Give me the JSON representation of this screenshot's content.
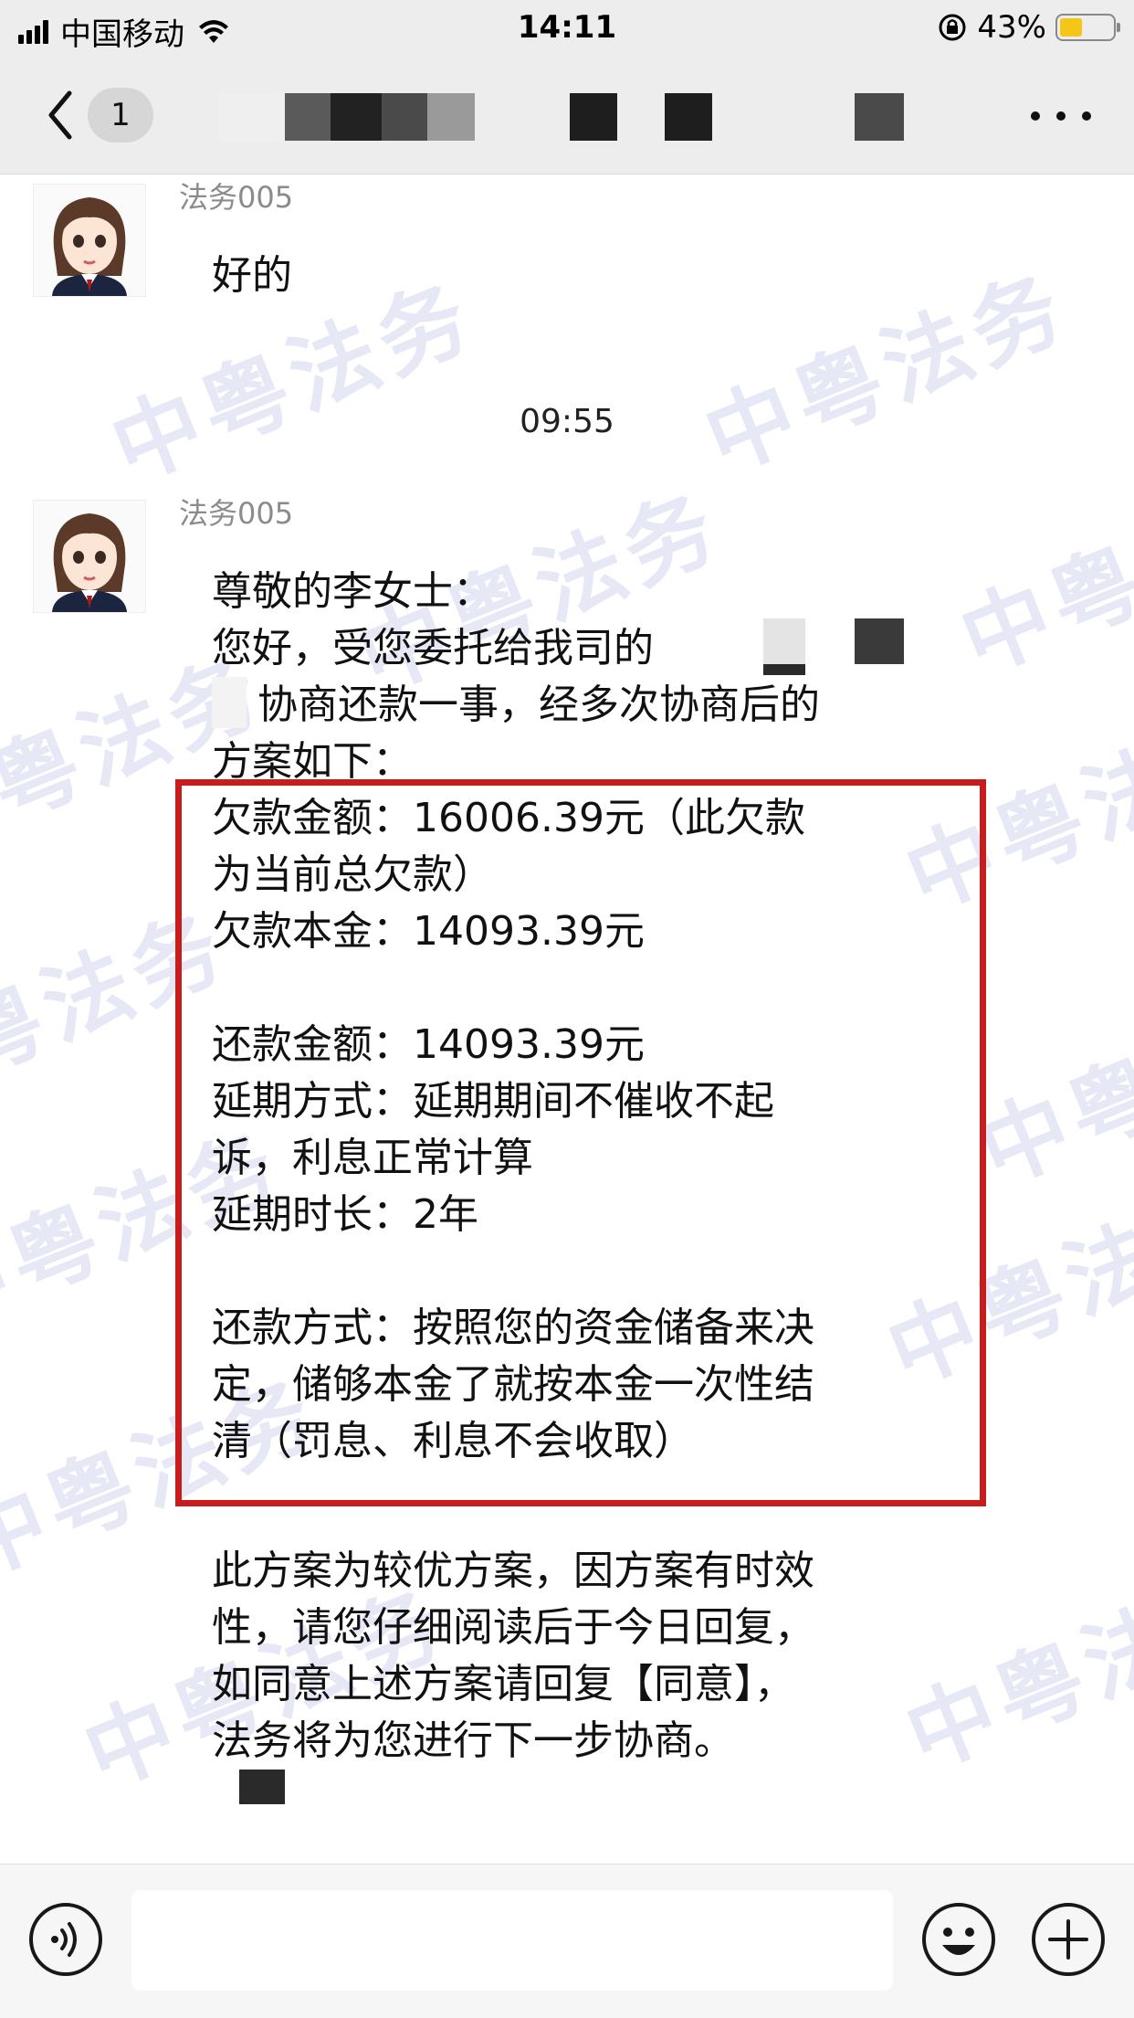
{
  "status_bar": {
    "carrier": "中国移动",
    "time": "14:11",
    "battery_percent": "43%",
    "battery_level": 0.43,
    "icons": [
      "signal-icon",
      "wifi-icon",
      "orientation-lock-icon",
      "battery-icon"
    ]
  },
  "nav": {
    "back_icon": "chevron-left-icon",
    "unread_count": "1",
    "more_icon": "more-icon"
  },
  "watermark_text": "中粤法务",
  "messages": [
    {
      "sender": "法务005",
      "lines": [
        "好的"
      ]
    }
  ],
  "timestamp": "09:55",
  "message2": {
    "sender": "法务005",
    "intro": [
      "尊敬的李女士：",
      "您好，受您委托给我司的",
      "协商还款一事，经多次协商后的",
      "方案如下："
    ],
    "boxed": [
      "欠款金额：16006.39元（此欠款",
      "为当前总欠款）",
      "欠款本金：14093.39元",
      "",
      "还款金额：14093.39元",
      "延期方式：延期期间不催收不起",
      "诉，利息正常计算",
      "延期时长：2年",
      "",
      "还款方式：按照您的资金储备来决",
      "定，储够本金了就按本金一次性结",
      "清（罚息、利息不会收取）"
    ],
    "outro": [
      "此方案为较优方案，因方案有时效",
      "性，请您仔细阅读后于今日回复，",
      "如同意上述方案请回复【同意】，",
      "法务将为您进行下一步协商。"
    ]
  },
  "input_bar": {
    "voice_icon": "voice-icon",
    "placeholder": "",
    "emoji_icon": "emoji-icon",
    "plus_icon": "plus-icon"
  },
  "colors": {
    "highlight_border": "#c81d1d",
    "bar_background": "#ededed",
    "battery_fill": "#f5c518"
  }
}
